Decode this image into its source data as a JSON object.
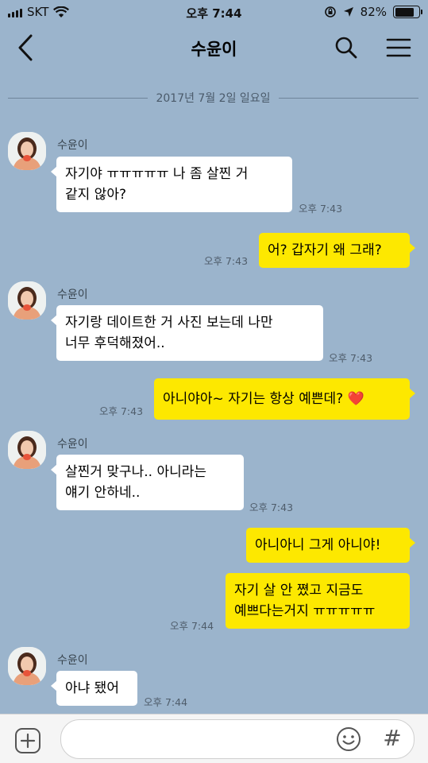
{
  "status_bar": {
    "carrier": "SKT",
    "time": "오후 7:44",
    "battery_percent": "82%",
    "battery_level": 0.82
  },
  "header": {
    "title": "수윤이",
    "icons": [
      "back-arrow-icon",
      "search-icon",
      "menu-icon"
    ]
  },
  "date_divider": "2017년 7월 2일 일요일",
  "messages": [
    {
      "side": "in",
      "sender": "수윤이",
      "lines": [
        "자기야 ㅠㅠㅠㅠㅠ 나 좀 살찐 거",
        "같지 않아?"
      ],
      "time": "오후 7:43"
    },
    {
      "side": "out",
      "lines": [
        "어? 갑자기 왜 그래?"
      ],
      "time": "오후 7:43"
    },
    {
      "side": "in",
      "sender": "수윤이",
      "lines": [
        "자기랑 데이트한 거 사진 보는데 나만",
        "너무 후덕해졌어.."
      ],
      "time": "오후 7:43"
    },
    {
      "side": "out",
      "lines": [
        "아니야아~ 자기는 항상 예쁜데? ❤️"
      ],
      "time": "오후 7:43"
    },
    {
      "side": "in",
      "sender": "수윤이",
      "lines": [
        "살찐거 맞구나.. 아니라는",
        "얘기 안하네.."
      ],
      "time": "오후 7:43"
    },
    {
      "side": "out",
      "lines": [
        "아니아니 그게 아니야!"
      ]
    },
    {
      "side": "out",
      "lines": [
        "자기 살 안 쪘고 지금도",
        "예쁘다는거지 ㅠㅠㅠㅠㅠ"
      ],
      "time": "오후 7:44"
    },
    {
      "side": "in",
      "sender": "수윤이",
      "lines": [
        "아냐 됐어"
      ],
      "time": "오후 7:44"
    }
  ],
  "input_bar": {
    "placeholder": "",
    "hash_symbol": "#"
  },
  "colors": {
    "background": "#9bb4cc",
    "my_bubble": "#fde800",
    "their_bubble": "#ffffff"
  }
}
